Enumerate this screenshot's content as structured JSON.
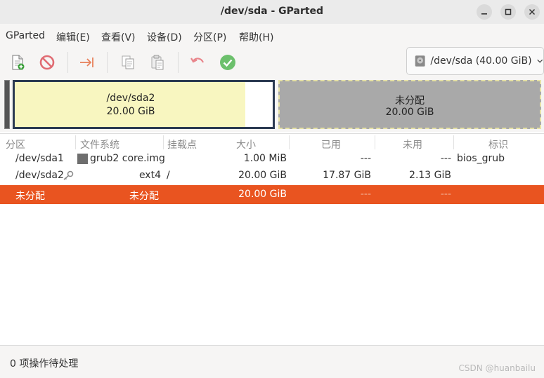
{
  "window": {
    "title": "/dev/sda - GParted"
  },
  "menu": [
    {
      "label": "GParted"
    },
    {
      "label": "编辑(E)"
    },
    {
      "label": "查看(V)"
    },
    {
      "label": "设备(D)"
    },
    {
      "label": "分区(P)"
    },
    {
      "label": "帮助(H)"
    }
  ],
  "toolbar": {
    "icons": [
      "new-partition-icon",
      "delete-partition-icon",
      "resize-move-icon",
      "copy-icon",
      "paste-icon",
      "undo-icon",
      "apply-icon"
    ]
  },
  "device_selector": {
    "value": "/dev/sda (40.00 GiB)",
    "icon": "hard-disk-icon"
  },
  "disk_map": {
    "sda2": {
      "name": "/dev/sda2",
      "size": "20.00 GiB",
      "used_fraction": 0.8935,
      "fill_color": "#f8f6c0",
      "border_color": "#2b3a52"
    },
    "unallocated": {
      "name": "未分配",
      "size": "20.00 GiB",
      "color": "#a9a9a9"
    }
  },
  "table": {
    "headers": [
      "分区",
      "文件系统",
      "挂载点",
      "大小",
      "已用",
      "未用",
      "标识"
    ],
    "rows": [
      {
        "partition": "/dev/sda1",
        "filesystem": "grub2 core.img",
        "fs_color": "#6e6e6e",
        "mount": "",
        "size": "1.00 MiB",
        "used": "---",
        "unused": "---",
        "flags": "bios_grub"
      },
      {
        "partition": "/dev/sda2",
        "filesystem": "ext4",
        "fs_color": "#314e6c",
        "mount": "/",
        "size": "20.00 GiB",
        "used": "17.87 GiB",
        "unused": "2.13 GiB",
        "flags": "",
        "key_icon": "key-icon"
      },
      {
        "partition": "未分配",
        "filesystem": "未分配",
        "fs_color": "#a9a9a9",
        "mount": "",
        "size": "20.00 GiB",
        "used": "---",
        "unused": "---",
        "flags": "",
        "selected": true
      }
    ]
  },
  "status": {
    "text": "0 项操作待处理"
  },
  "watermark": {
    "text": "CSDN @huanbailu"
  },
  "colors": {
    "accent": "#e95420",
    "titlebar": "#ebebeb",
    "toolbar": "#f6f5f4"
  }
}
